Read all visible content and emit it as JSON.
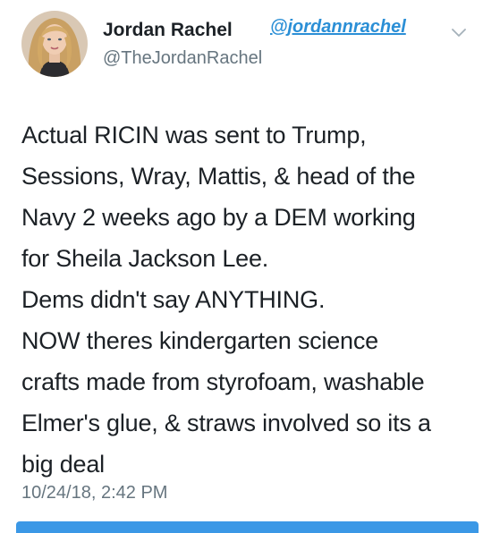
{
  "tweet": {
    "author": {
      "display_name": "Jordan Rachel",
      "username": "@TheJordanRachel",
      "avatar_icon": "profile-photo"
    },
    "overlay_handle": "@jordannrachel",
    "menu_icon": "chevron-down-icon",
    "text_lines": [
      "Actual RICIN was sent to Trump,",
      "Sessions, Wray, Mattis, & head of the",
      "Navy 2 weeks ago by a DEM working",
      "for Sheila Jackson Lee.",
      "Dems didn't say ANYTHING.",
      "NOW theres kindergarten science",
      "crafts made from styrofoam, washable",
      "Elmer's glue, & straws involved so its a",
      "big deal"
    ],
    "timestamp": "10/24/18, 2:42 PM"
  },
  "colors": {
    "text": "#1c2126",
    "secondary_text": "#66757f",
    "overlay_link": "#2b8fd6",
    "bottom_bar": "#3b98e6",
    "background": "#ffffff"
  }
}
